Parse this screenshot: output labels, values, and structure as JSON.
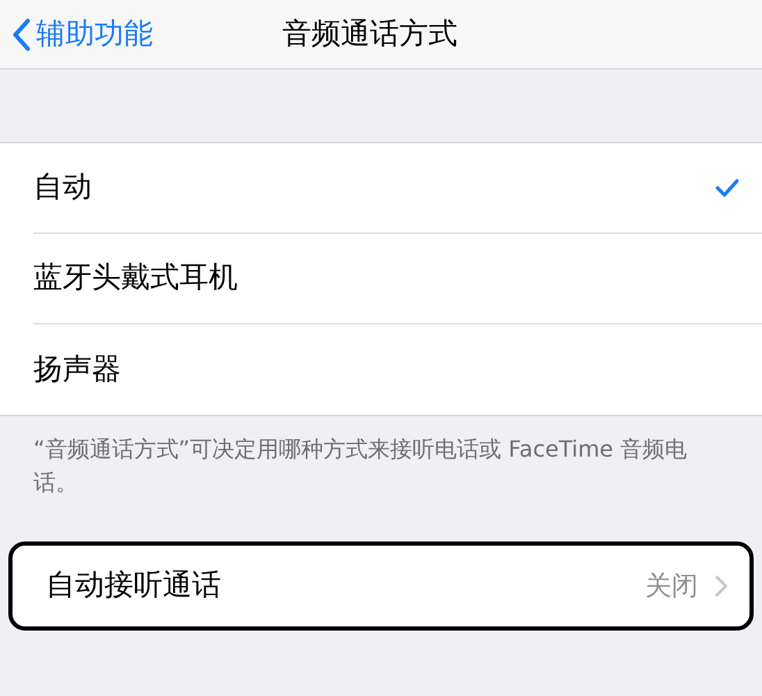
{
  "nav": {
    "back": "辅助功能",
    "title": "音频通话方式"
  },
  "options": [
    {
      "label": "自动",
      "selected": true
    },
    {
      "label": "蓝牙头戴式耳机",
      "selected": false
    },
    {
      "label": "扬声器",
      "selected": false
    }
  ],
  "footer": "“音频通话方式”可决定用哪种方式来接听电话或 FaceTime 音频电话。",
  "auto_answer": {
    "label": "自动接听通话",
    "value": "关闭",
    "highlighted": true
  }
}
